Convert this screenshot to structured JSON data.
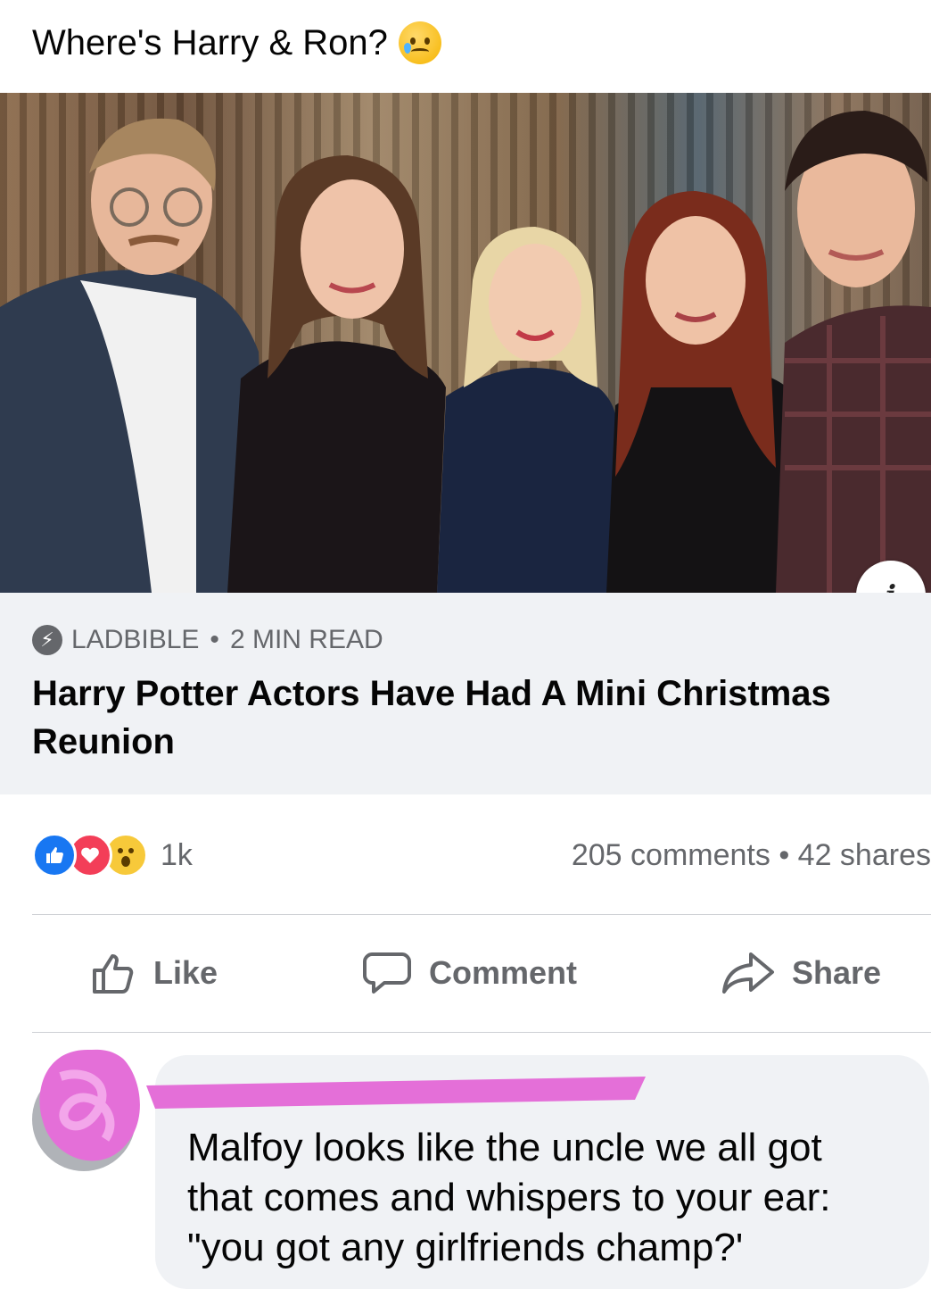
{
  "post": {
    "text": "Where's Harry & Ron?",
    "emoji": "sad-but-relieved-face-icon"
  },
  "link": {
    "source": "LADBIBLE",
    "read_time": "2 MIN READ",
    "separator": "•",
    "title": "Harry Potter Actors Have Had A Mini Christmas Reunion",
    "info_label": "i"
  },
  "reactions": {
    "icons": [
      "like-icon",
      "love-icon",
      "wow-icon"
    ],
    "count": "1k",
    "comments": "205 comments",
    "separator": "•",
    "shares": "42 shares"
  },
  "actions": {
    "like": "Like",
    "comment": "Comment",
    "share": "Share"
  },
  "comment": {
    "text": "Malfoy looks like the uncle we all got that comes and whispers to your ear: \"you got any girlfriends champ?'"
  },
  "colors": {
    "accent_blue": "#1877f2",
    "love_red": "#f33e58",
    "wow_yellow": "#f7c93a",
    "redaction_pink": "#e46fd8",
    "card_bg": "#f0f2f5",
    "muted_text": "#65676b"
  }
}
